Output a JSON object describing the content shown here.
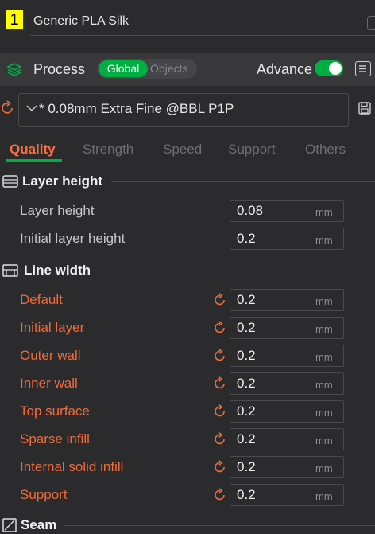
{
  "filament": {
    "index": "1",
    "name": "Generic PLA Silk"
  },
  "process": {
    "title": "Process",
    "scope_global": "Global",
    "scope_objects": "Objects",
    "advance_label": "Advance",
    "advance_on": true
  },
  "preset": {
    "name": "* 0.08mm Extra Fine @BBL P1P"
  },
  "tabs": [
    {
      "label": "Quality",
      "active": true
    },
    {
      "label": "Strength",
      "active": false
    },
    {
      "label": "Speed",
      "active": false
    },
    {
      "label": "Support",
      "active": false
    },
    {
      "label": "Others",
      "active": false
    }
  ],
  "sections": {
    "layer_height": {
      "title": "Layer height",
      "rows": [
        {
          "label": "Layer height",
          "value": "0.08",
          "unit": "mm",
          "modified": false
        },
        {
          "label": "Initial layer height",
          "value": "0.2",
          "unit": "mm",
          "modified": false
        }
      ]
    },
    "line_width": {
      "title": "Line width",
      "rows": [
        {
          "label": "Default",
          "value": "0.2",
          "unit": "mm",
          "modified": true
        },
        {
          "label": "Initial layer",
          "value": "0.2",
          "unit": "mm",
          "modified": true
        },
        {
          "label": "Outer wall",
          "value": "0.2",
          "unit": "mm",
          "modified": true
        },
        {
          "label": "Inner wall",
          "value": "0.2",
          "unit": "mm",
          "modified": true
        },
        {
          "label": "Top surface",
          "value": "0.2",
          "unit": "mm",
          "modified": true
        },
        {
          "label": "Sparse infill",
          "value": "0.2",
          "unit": "mm",
          "modified": true
        },
        {
          "label": "Internal solid infill",
          "value": "0.2",
          "unit": "mm",
          "modified": true
        },
        {
          "label": "Support",
          "value": "0.2",
          "unit": "mm",
          "modified": true
        }
      ]
    },
    "seam": {
      "title": "Seam"
    }
  },
  "colors": {
    "accent_green": "#00ae42",
    "modified_orange": "#f06b3b",
    "active_tab": "#ff6f3c",
    "badge_yellow": "#ffff00"
  },
  "icons": {
    "process": "layers-icon",
    "compare": "compare-icon",
    "reset": "reset-arrow-icon",
    "save": "save-icon",
    "chevron": "chevron-down-icon"
  }
}
